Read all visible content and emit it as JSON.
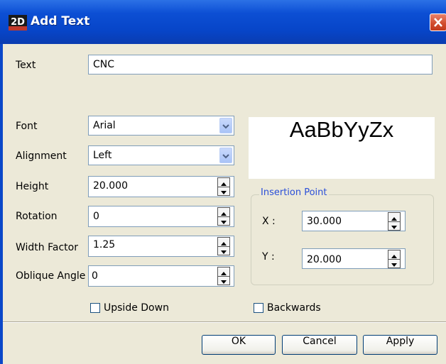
{
  "window": {
    "title": "Add Text",
    "icon_label": "2D"
  },
  "form": {
    "text_label": "Text",
    "text_value": "CNC",
    "font_label": "Font",
    "font_value": "Arial",
    "alignment_label": "Alignment",
    "alignment_value": "Left",
    "height_label": "Height",
    "height_value": "20.000",
    "rotation_label": "Rotation",
    "rotation_value": "0",
    "width_factor_label": "Width Factor",
    "width_factor_value": "1.25",
    "oblique_angle_label": "Oblique Angle",
    "oblique_angle_value": "0"
  },
  "preview": {
    "sample_text": "AaBbYyZx"
  },
  "insertion_point": {
    "title": "Insertion Point",
    "x_label": "X :",
    "x_value": "30.000",
    "y_label": "Y :",
    "y_value": "20.000"
  },
  "options": {
    "upside_down_label": "Upside Down",
    "upside_down_checked": false,
    "backwards_label": "Backwards",
    "backwards_checked": false
  },
  "buttons": {
    "ok": "OK",
    "cancel": "Cancel",
    "apply": "Apply"
  },
  "colors": {
    "titlebar": "#0a4fd4",
    "dialog_bg": "#ece9d8",
    "group_title": "#2a4fd9",
    "close_button": "#d04a2b"
  }
}
